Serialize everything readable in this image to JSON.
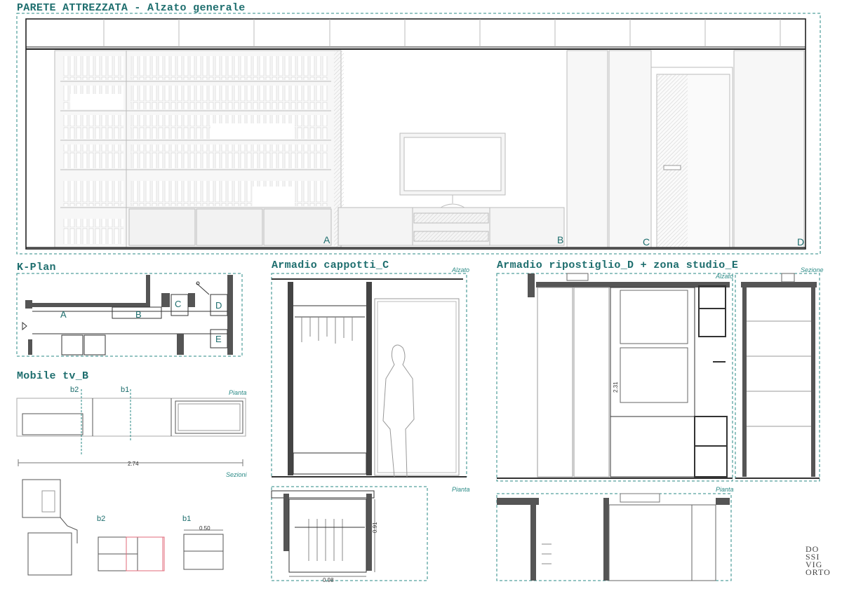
{
  "sheet": {
    "main_title": "PARETE ATTREZZATA - Alzato generale",
    "elevation_tags": [
      "A",
      "B",
      "C",
      "D"
    ],
    "panels": {
      "kplan": {
        "title": "K-Plan",
        "tags": [
          "A",
          "B",
          "C",
          "D",
          "E"
        ]
      },
      "mobile_tv": {
        "title": "Mobile tv_B",
        "view_plan": "Pianta",
        "view_sections": "Sezioni",
        "section_marks": [
          "b2",
          "b1"
        ],
        "section_titles": [
          "b2",
          "b1"
        ],
        "dimension_total": "2.74",
        "dimension_b1": "0.50"
      },
      "armadio_c": {
        "title": "Armadio cappotti_C",
        "view_elevation": "Alzato",
        "view_plan": "Pianta",
        "dimension_depth": "0.91",
        "dimension_width": "0.98"
      },
      "armadio_d": {
        "title": "Armadio ripostiglio_D + zona studio_E",
        "view_elevation": "Alzato",
        "view_section": "Sezione",
        "view_plan": "Pianta",
        "dimension_height": "2.31"
      }
    },
    "logo_lines": [
      "DO",
      "SSI",
      "VIG",
      "ORTO"
    ],
    "accent_color": "#2a8a86",
    "line_color": "#333333"
  }
}
